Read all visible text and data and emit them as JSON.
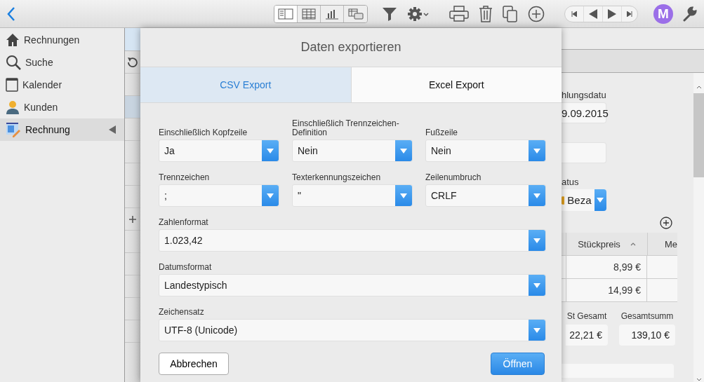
{
  "toolbar": {
    "avatar": "M"
  },
  "sidebar": {
    "items": [
      {
        "label": "Rechnungen",
        "selected": false
      },
      {
        "label": "Suche",
        "selected": false
      },
      {
        "label": "Kalender",
        "selected": false
      },
      {
        "label": "Kunden",
        "selected": false
      },
      {
        "label": "Rechnung",
        "selected": true
      }
    ]
  },
  "dialog": {
    "title": "Daten exportieren",
    "tabs": [
      {
        "label": "CSV Export",
        "selected": true
      },
      {
        "label": "Excel Export",
        "selected": false
      }
    ],
    "fields": [
      {
        "label": "Einschließlich Kopfzeile",
        "value": "Ja",
        "kind": "narrow"
      },
      {
        "label": "Einschließlich Trennzeichen-Definition",
        "value": "Nein",
        "kind": "narrow"
      },
      {
        "label": "Fußzeile",
        "value": "Nein",
        "kind": "narrow"
      },
      {
        "label": "Trennzeichen",
        "value": ";",
        "kind": "narrow"
      },
      {
        "label": "Texterkennungszeichen",
        "value": "\"",
        "kind": "narrow"
      },
      {
        "label": "Zeilenumbruch",
        "value": "CRLF",
        "kind": "narrow"
      },
      {
        "label": "Zahlenformat",
        "value": "1.023,42",
        "kind": "wide"
      },
      {
        "label": "Datumsformat",
        "value": "Landestypisch",
        "kind": "wide"
      },
      {
        "label": "Zeichensatz",
        "value": "UTF-8 (Unicode)",
        "kind": "wide"
      }
    ],
    "cancel": "Abbrechen",
    "confirm": "Öffnen"
  },
  "detail": {
    "date_label": "hlungsdatu",
    "date_value": "9.09.2015",
    "status_label": "atus",
    "status_value": "Beza",
    "table": {
      "columns": [
        "Stückpreis",
        "Me"
      ],
      "rows": [
        [
          "8,99 €"
        ],
        [
          "14,99 €"
        ]
      ]
    },
    "totals": [
      {
        "label": "St Gesamt",
        "value": "22,21 €"
      },
      {
        "label": "Gesamtsumm",
        "value": "139,10 €"
      }
    ]
  }
}
